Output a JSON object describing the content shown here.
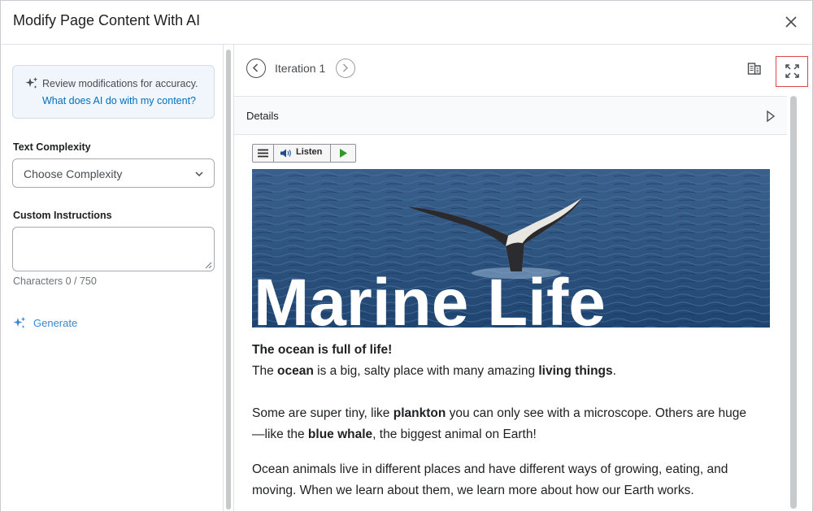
{
  "dialog": {
    "title": "Modify Page Content With AI"
  },
  "left_panel": {
    "notice": {
      "text": "Review modifications for accuracy.",
      "link": "What does AI do with my content?"
    },
    "text_complexity": {
      "label": "Text Complexity",
      "value": "Choose Complexity"
    },
    "custom_instructions": {
      "label": "Custom Instructions",
      "value": "",
      "char_count": "Characters 0 / 750"
    },
    "generate_label": "Generate"
  },
  "right_panel": {
    "iteration_label": "Iteration 1",
    "details_label": "Details",
    "listen_label": "Listen",
    "hero_title": "Marine Life",
    "paragraphs": {
      "p1_heading": "The ocean is full of life!",
      "p1_a": "The ",
      "p1_b": "ocean",
      "p1_c": " is a big, salty place with many amazing ",
      "p1_d": "living things",
      "p1_e": ".",
      "p2_a": "Some are super tiny, like ",
      "p2_b": "plankton",
      "p2_c": " you can only see with a microscope. Others are huge",
      "p2_d": "—like the ",
      "p2_e": "blue whale",
      "p2_f": ", the biggest animal on Earth!",
      "p3_a": "Ocean animals live in different places and have different ways of growing, eating, and",
      "p3_b": "moving. When we learn about them, we learn more about how our Earth works."
    }
  },
  "colors": {
    "link": "#006fbf",
    "generate": "#3b87d0",
    "highlight_border": "#e0454e",
    "ocean": "#2e5580"
  },
  "icons": {
    "close": "close-icon",
    "sparkle": "sparkle-icon",
    "chevron": "chevron-down-icon",
    "prev": "arrow-left-circle-icon",
    "next": "arrow-right-circle-icon",
    "compare": "compare-document-icon",
    "expand": "fullscreen-expand-icon",
    "details": "triangle-right-icon",
    "menu": "hamburger-menu-icon",
    "speaker": "speaker-icon",
    "play": "play-icon"
  }
}
